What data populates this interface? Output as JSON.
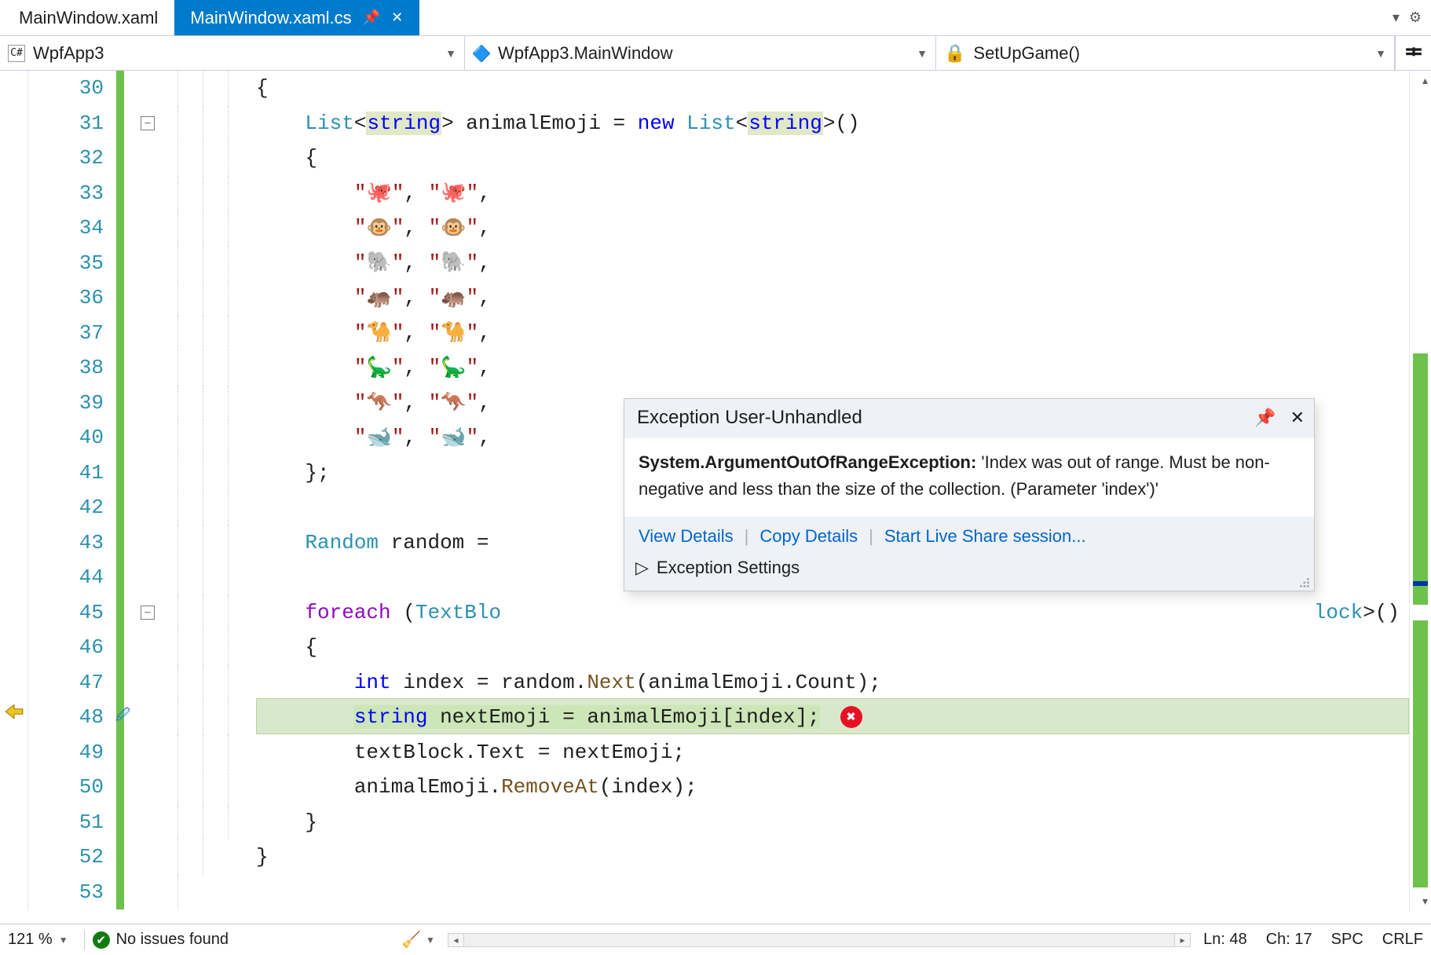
{
  "tabs": {
    "inactive": "MainWindow.xaml",
    "active": "MainWindow.xaml.cs"
  },
  "nav": {
    "project": "WpfApp3",
    "class": "WpfApp3.MainWindow",
    "member": "SetUpGame()"
  },
  "lines": {
    "start": 30,
    "end": 53,
    "current": 48,
    "fold_lines": [
      31,
      45
    ]
  },
  "code": {
    "l30": "{",
    "l31_a": "List",
    "l31_b": "string",
    "l31_c": "animalEmoji",
    "l31_d": "new",
    "l31_e": "List",
    "l31_f": "string",
    "l32": "{",
    "emojiRows": [
      {
        "e": "🐙"
      },
      {
        "e": "🐵"
      },
      {
        "e": "🐘"
      },
      {
        "e": "🦛"
      },
      {
        "e": "🐪"
      },
      {
        "e": "🦕"
      },
      {
        "e": "🦘"
      },
      {
        "e": "🐋"
      }
    ],
    "l41": "};",
    "l43_a": "Random",
    "l43_b": "random",
    "l43_c": "=",
    "l45_a": "foreach",
    "l45_b": "TextBlo",
    "l45_c": "lock",
    "l45_d": ">()",
    "l46": "{",
    "l47_a": "int",
    "l47_b": "index",
    "l47_c": "random",
    "l47_d": "Next",
    "l47_e": "animalEmoji",
    "l47_f": "Count",
    "l48_a": "string",
    "l48_b": "nextEmoji",
    "l48_c": "animalEmoji",
    "l48_d": "index",
    "l49_a": "textBlock",
    "l49_b": "Text",
    "l49_c": "nextEmoji",
    "l50_a": "animalEmoji",
    "l50_b": "RemoveAt",
    "l50_c": "index",
    "l51": "}",
    "l52": "}",
    "l53": "}"
  },
  "exception": {
    "title": "Exception User-Unhandled",
    "type": "System.ArgumentOutOfRangeException:",
    "msg": "'Index was out of range. Must be non-negative and less than the size of the collection. (Parameter 'index')'",
    "links": {
      "view": "View Details",
      "copy": "Copy Details",
      "live": "Start Live Share session..."
    },
    "settings": "Exception Settings"
  },
  "status": {
    "zoom": "121 %",
    "issues": "No issues found",
    "ln": "Ln: 48",
    "ch": "Ch: 17",
    "spc": "SPC",
    "crlf": "CRLF"
  }
}
